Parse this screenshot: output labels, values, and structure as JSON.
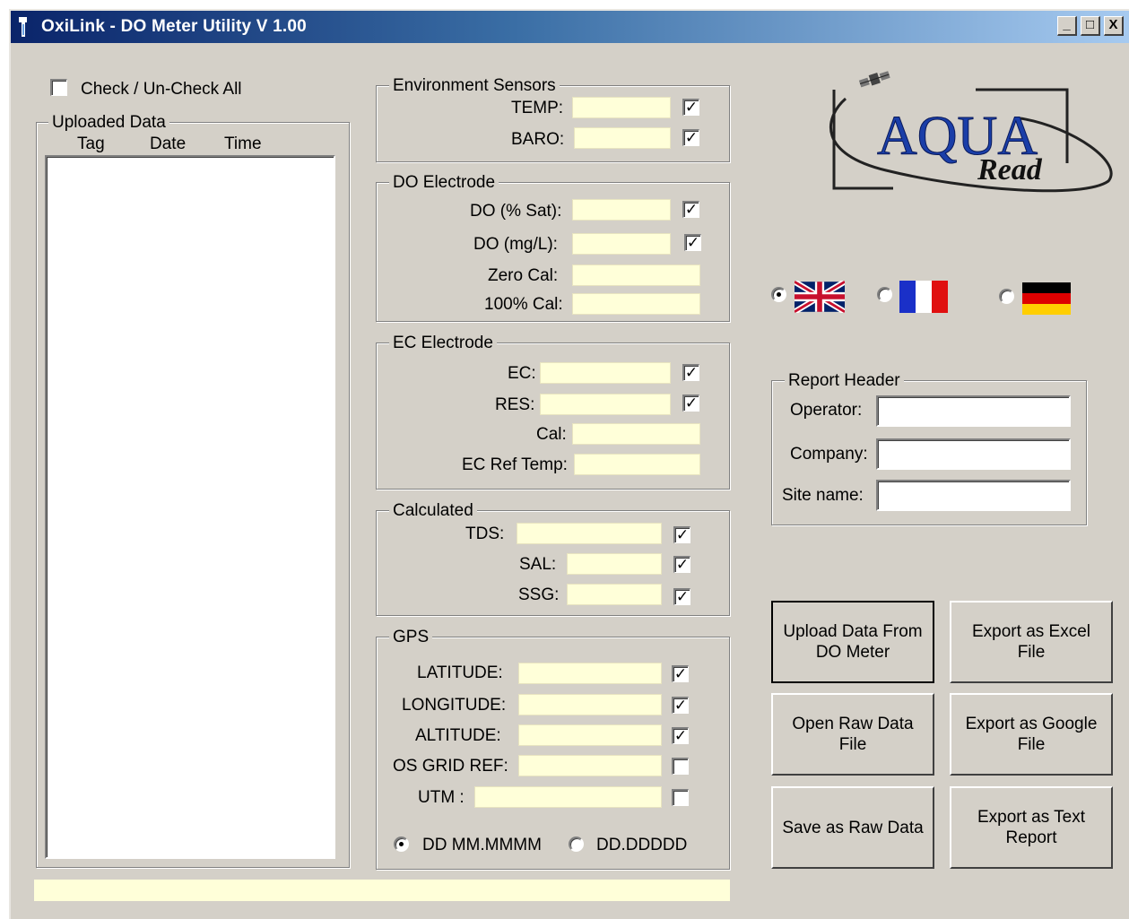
{
  "window": {
    "title": "OxiLink - DO Meter Utility V 1.00",
    "controls": {
      "minimize": "_",
      "maximize": "□",
      "close": "X"
    }
  },
  "check_all": {
    "label": "Check / Un-Check All",
    "checked": false
  },
  "uploaded_data": {
    "legend": "Uploaded Data",
    "columns": [
      "Tag",
      "Date",
      "Time"
    ],
    "rows": []
  },
  "environment": {
    "legend": "Environment Sensors",
    "temp": {
      "label": "TEMP:",
      "value": "",
      "checked": true
    },
    "baro": {
      "label": "BARO:",
      "value": "",
      "checked": true
    }
  },
  "do_electrode": {
    "legend": "DO Electrode",
    "do_sat": {
      "label": "DO (% Sat):",
      "value": "",
      "checked": true
    },
    "do_mgl": {
      "label": "DO (mg/L):",
      "value": "",
      "checked": true
    },
    "zero_cal": {
      "label": "Zero Cal:",
      "value": ""
    },
    "cal_100": {
      "label": "100% Cal:",
      "value": ""
    }
  },
  "ec_electrode": {
    "legend": "EC Electrode",
    "ec": {
      "label": "EC:",
      "value": "",
      "checked": true
    },
    "res": {
      "label": "RES:",
      "value": "",
      "checked": true
    },
    "cal": {
      "label": "Cal:",
      "value": ""
    },
    "ref_temp": {
      "label": "EC Ref Temp:",
      "value": ""
    }
  },
  "calculated": {
    "legend": "Calculated",
    "tds": {
      "label": "TDS:",
      "value": "",
      "checked": true
    },
    "sal": {
      "label": "SAL:",
      "value": "",
      "checked": true
    },
    "ssg": {
      "label": "SSG:",
      "value": "",
      "checked": true
    }
  },
  "gps": {
    "legend": "GPS",
    "latitude": {
      "label": "LATITUDE:",
      "value": "",
      "checked": true
    },
    "longitude": {
      "label": "LONGITUDE:",
      "value": "",
      "checked": true
    },
    "altitude": {
      "label": "ALTITUDE:",
      "value": "",
      "checked": true
    },
    "os_grid": {
      "label": "OS GRID REF:",
      "value": "",
      "checked": false
    },
    "utm": {
      "label": "UTM :",
      "value": "",
      "checked": false
    },
    "format_options": [
      "DD MM.MMMM",
      "DD.DDDDD"
    ],
    "selected_format": "DD MM.MMMM"
  },
  "logo": {
    "text_main": "AQUA",
    "text_sub": "Read"
  },
  "languages": {
    "options": [
      "uk-flag-icon",
      "france-flag-icon",
      "germany-flag-icon"
    ],
    "selected": "uk-flag-icon"
  },
  "report_header": {
    "legend": "Report Header",
    "operator": {
      "label": "Operator:",
      "value": ""
    },
    "company": {
      "label": "Company:",
      "value": ""
    },
    "site_name": {
      "label": "Site name:",
      "value": ""
    }
  },
  "buttons": {
    "upload": "Upload Data From DO Meter",
    "export_excel": "Export as Excel File",
    "open_raw": "Open Raw Data File",
    "export_google": "Export as Google File",
    "save_raw": "Save as Raw Data",
    "export_text": "Export as Text Report"
  },
  "status_text": "",
  "colors": {
    "window_bg": "#d4d0c8",
    "field_bg": "#ffffd9",
    "title_start": "#0a246a",
    "title_end": "#a6caf0",
    "logo_blue": "#1a3ea8"
  }
}
